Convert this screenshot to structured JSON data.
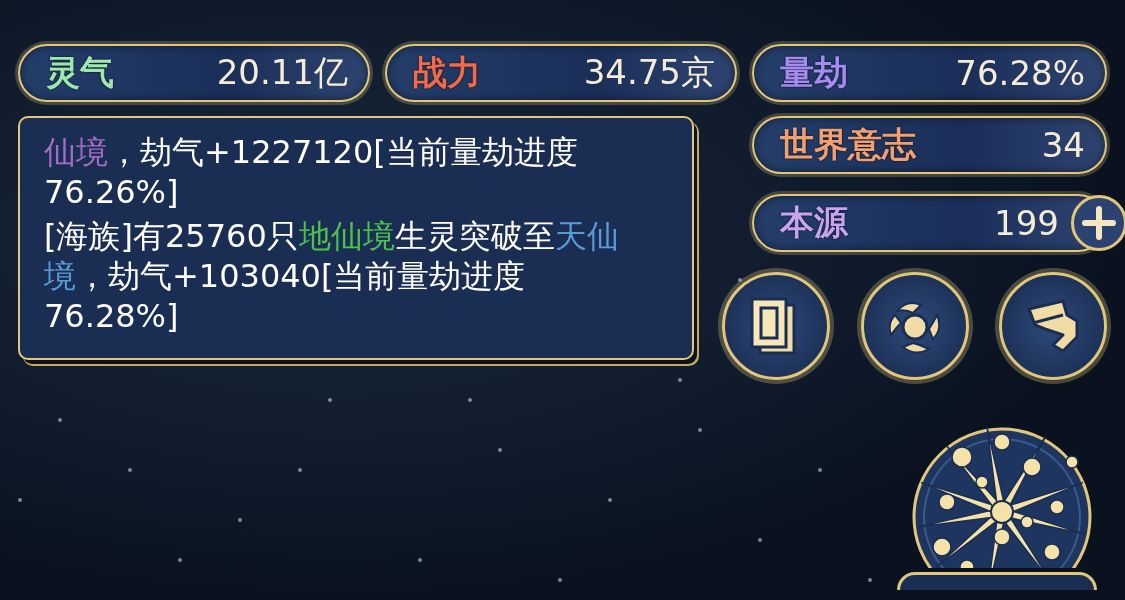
{
  "top_stats": [
    {
      "label": "灵气",
      "value": "20.11亿",
      "color": "#9ee8b0"
    },
    {
      "label": "战力",
      "value": "34.75京",
      "color": "#f26a4a"
    },
    {
      "label": "量劫",
      "value": "76.28%",
      "color": "#a68cf2"
    }
  ],
  "log": [
    {
      "segments": [
        {
          "text": "仙境",
          "color": "#a66cc4"
        },
        {
          "text": "，劫气+1227120[当前量劫进度76.26%]",
          "color": "#ffffff"
        }
      ]
    },
    {
      "segments": [
        {
          "text": "[海族]有25760只",
          "color": "#ffffff"
        },
        {
          "text": "地仙境",
          "color": "#4cc24c"
        },
        {
          "text": "生灵突破至",
          "color": "#ffffff"
        },
        {
          "text": "天仙境",
          "color": "#5a9ad6"
        },
        {
          "text": "，劫气+103040[当前量劫进度76.28%]",
          "color": "#ffffff"
        }
      ]
    }
  ],
  "side_stats": [
    {
      "label": "世界意志",
      "value": "34",
      "color": "#f2a070",
      "add_button": false
    },
    {
      "label": "本源",
      "value": "199",
      "color": "#c8a4f0",
      "add_button": true
    }
  ]
}
